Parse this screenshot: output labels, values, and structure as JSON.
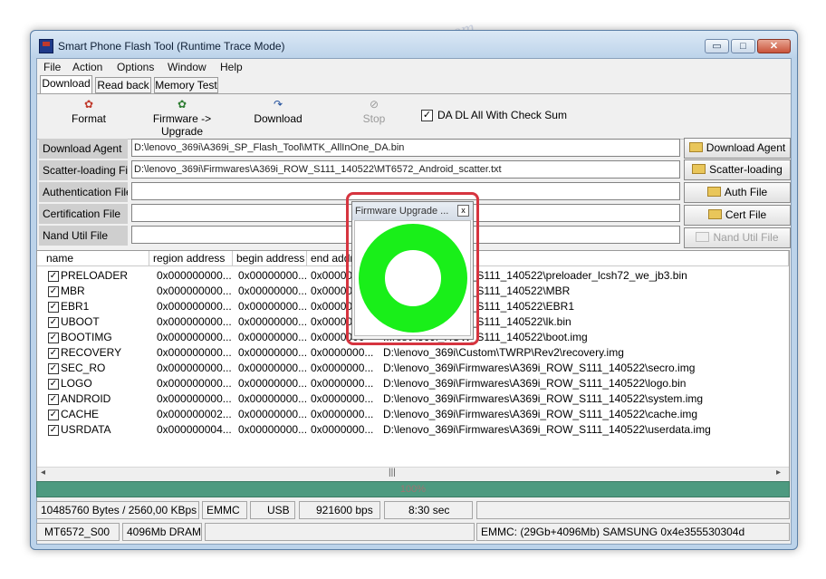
{
  "window": {
    "title": "Smart Phone Flash Tool (Runtime Trace Mode)",
    "controls": {
      "minimize": "▭",
      "maximize": "□",
      "close": "✕"
    }
  },
  "menu": [
    "File",
    "Action",
    "Options",
    "Window",
    "Help"
  ],
  "tabs": [
    {
      "label": "Download",
      "active": true
    },
    {
      "label": "Read back",
      "active": false
    },
    {
      "label": "Memory Test",
      "active": false
    }
  ],
  "toolbar": {
    "format": "Format",
    "firmware_upgrade": "Firmware -> Upgrade",
    "download": "Download",
    "stop": "Stop",
    "da_checksum_label": "DA DL All With Check Sum",
    "da_checksum_checked": true
  },
  "fields": {
    "download_agent": {
      "label": "Download Agent",
      "value": "D:\\lenovo_369i\\A369i_SP_Flash_Tool\\MTK_AllInOne_DA.bin",
      "button": "Download Agent"
    },
    "scatter": {
      "label": "Scatter-loading File",
      "value": "D:\\lenovo_369i\\Firmwares\\A369i_ROW_S111_140522\\MT6572_Android_scatter.txt",
      "button": "Scatter-loading"
    },
    "auth": {
      "label": "Authentication File",
      "value": "",
      "button": "Auth File"
    },
    "cert": {
      "label": "Certification File",
      "value": "",
      "button": "Cert File"
    },
    "nand": {
      "label": "Nand Util File",
      "value": "",
      "button": "Nand Util File"
    }
  },
  "table": {
    "headers": [
      "name",
      "region address",
      "begin address",
      "end addr",
      "location"
    ],
    "rows": [
      {
        "name": "PRELOADER",
        "region": "0x000000000...",
        "begin": "0x00000000...",
        "end": "0x0000000",
        "location": "...res\\A369i_ROW_S111_140522\\preloader_lcsh72_we_jb3.bin"
      },
      {
        "name": "MBR",
        "region": "0x000000000...",
        "begin": "0x00000000...",
        "end": "0x0000000",
        "location": "...res\\A369i_ROW_S111_140522\\MBR"
      },
      {
        "name": "EBR1",
        "region": "0x000000000...",
        "begin": "0x00000000...",
        "end": "0x0000000",
        "location": "...res\\A369i_ROW_S111_140522\\EBR1"
      },
      {
        "name": "UBOOT",
        "region": "0x000000000...",
        "begin": "0x00000000...",
        "end": "0x0000000",
        "location": "...res\\A369i_ROW_S111_140522\\lk.bin"
      },
      {
        "name": "BOOTIMG",
        "region": "0x000000000...",
        "begin": "0x00000000...",
        "end": "0x0000000",
        "location": "...res\\A369i_ROW_S111_140522\\boot.img"
      },
      {
        "name": "RECOVERY",
        "region": "0x000000000...",
        "begin": "0x00000000...",
        "end": "0x0000000...",
        "location": "D:\\lenovo_369i\\Custom\\TWRP\\Rev2\\recovery.img"
      },
      {
        "name": "SEC_RO",
        "region": "0x000000000...",
        "begin": "0x00000000...",
        "end": "0x0000000...",
        "location": "D:\\lenovo_369i\\Firmwares\\A369i_ROW_S111_140522\\secro.img"
      },
      {
        "name": "LOGO",
        "region": "0x000000000...",
        "begin": "0x00000000...",
        "end": "0x0000000...",
        "location": "D:\\lenovo_369i\\Firmwares\\A369i_ROW_S111_140522\\logo.bin"
      },
      {
        "name": "ANDROID",
        "region": "0x000000000...",
        "begin": "0x00000000...",
        "end": "0x0000000...",
        "location": "D:\\lenovo_369i\\Firmwares\\A369i_ROW_S111_140522\\system.img"
      },
      {
        "name": "CACHE",
        "region": "0x000000002...",
        "begin": "0x00000000...",
        "end": "0x0000000...",
        "location": "D:\\lenovo_369i\\Firmwares\\A369i_ROW_S111_140522\\cache.img"
      },
      {
        "name": "USRDATA",
        "region": "0x000000004...",
        "begin": "0x00000000...",
        "end": "0x0000000...",
        "location": "D:\\lenovo_369i\\Firmwares\\A369i_ROW_S111_140522\\userdata.img"
      }
    ]
  },
  "progress": {
    "label": "100%",
    "fraction": 1.0
  },
  "status": {
    "bytes": "10485760 Bytes / 2560,00 KBps",
    "storage": "EMMC",
    "port": "USB",
    "baud": "921600 bps",
    "time": "8:30 sec",
    "chip": "MT6572_S00",
    "ram": "4096Mb DRAM",
    "emmc_info": "EMMC: (29Gb+4096Mb) SAMSUNG 0x4e355530304d"
  },
  "popup": {
    "title": "Firmware Upgrade ...",
    "close": "x"
  },
  "colors": {
    "progress": "#4d9a80",
    "ring": "#19ef19",
    "highlight": "#d6343f"
  },
  "watermark": "Sovietpersper.com"
}
